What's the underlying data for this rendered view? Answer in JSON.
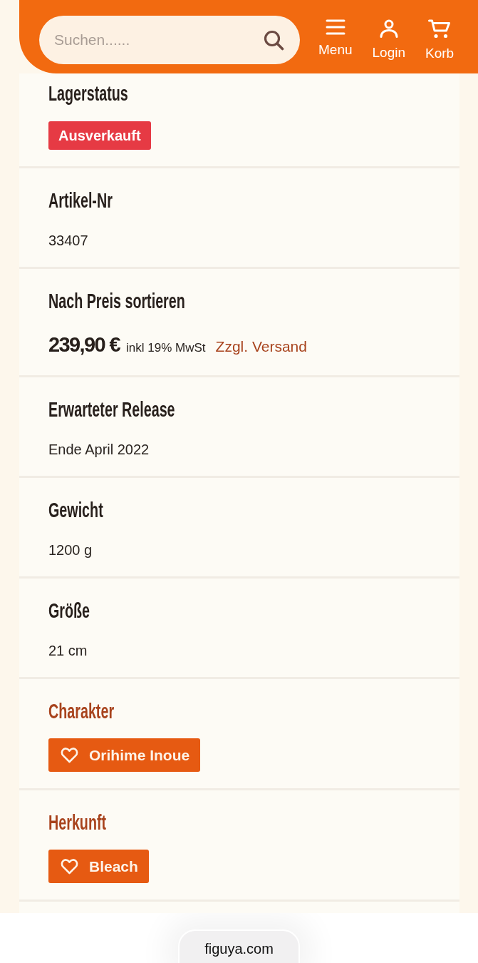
{
  "header": {
    "search": {
      "placeholder": "Suchen......"
    },
    "nav": [
      {
        "label": "Menu"
      },
      {
        "label": "Login"
      },
      {
        "label": "Korb"
      }
    ]
  },
  "details": [
    {
      "kind": "badge",
      "title": "Lagerstatus",
      "value": "Ausverkauft"
    },
    {
      "kind": "text",
      "title": "Artikel-Nr",
      "value": "33407"
    },
    {
      "kind": "price",
      "title": "Nach Preis sortieren",
      "price": "239,90 €",
      "tax": "inkl 19% MwSt",
      "shipping": "Zzgl. Versand"
    },
    {
      "kind": "text",
      "title": "Erwarteter Release",
      "value": "Ende April 2022"
    },
    {
      "kind": "text",
      "title": "Gewicht",
      "value": "1200 g"
    },
    {
      "kind": "text",
      "title": "Größe",
      "value": "21 cm"
    },
    {
      "kind": "tag",
      "title": "Charakter",
      "value": "Orihime Inoue"
    },
    {
      "kind": "tag",
      "title": "Herkunft",
      "value": "Bleach"
    }
  ],
  "browser": {
    "url": "figuya.com"
  }
}
